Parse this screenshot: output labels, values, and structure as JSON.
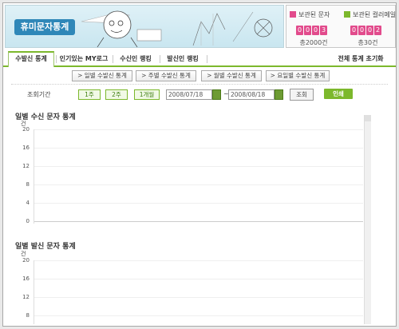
{
  "banner": {
    "logo": "휴미문자통계"
  },
  "counters": [
    {
      "label": "보관된 문자",
      "digits": [
        "0",
        "0",
        "0",
        "3"
      ],
      "sub": "총2000건",
      "color": "#e24b8c"
    },
    {
      "label": "보관된 컬러메일",
      "digits": [
        "0",
        "0",
        "0",
        "2"
      ],
      "sub": "총30건",
      "color": "#7cb82c"
    }
  ],
  "tabs": [
    {
      "label": "수발신 통계",
      "active": true
    },
    {
      "label": "인기있는 MY로그",
      "active": false
    },
    {
      "label": "수신인 랭킹",
      "active": false
    },
    {
      "label": "발신인 랭킹",
      "active": false
    },
    {
      "label": "전체 통계 초기화",
      "active": false
    }
  ],
  "sub_buttons": [
    "> 일별 수발신 통계",
    "> 주별 수발신 통계",
    "> 월별 수발신 통계",
    "> 요일별 수발신 통계"
  ],
  "query": {
    "label": "조회기간",
    "ranges": [
      "1주",
      "2주",
      "1개월"
    ],
    "start_date": "2008/07/18",
    "tilde": "~",
    "end_date": "2008/08/18",
    "search": "조회",
    "print": "인쇄"
  },
  "charts": [
    {
      "title": "일별 수신 문자 통계",
      "unit": "건",
      "y_ticks": [
        "20",
        "16",
        "12",
        "8",
        "4",
        "0"
      ]
    },
    {
      "title": "일별 발신 문자 통계",
      "unit": "건",
      "y_ticks": [
        "20",
        "16",
        "12",
        "8"
      ]
    }
  ]
}
